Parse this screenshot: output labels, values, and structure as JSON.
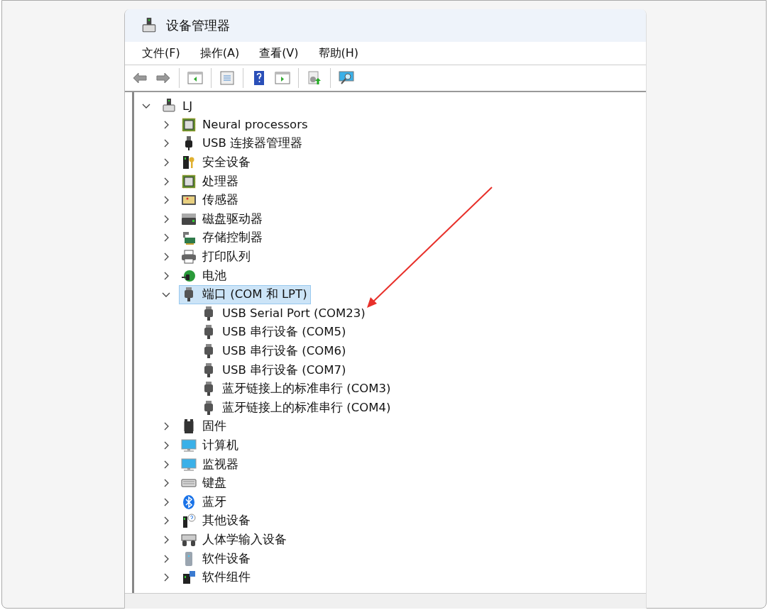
{
  "window": {
    "title": "设备管理器"
  },
  "menu": [
    {
      "label": "文件(F)"
    },
    {
      "label": "操作(A)"
    },
    {
      "label": "查看(V)"
    },
    {
      "label": "帮助(H)"
    }
  ],
  "tree": {
    "label": "LJ",
    "expanded": true,
    "selected": false,
    "children": [
      {
        "label": "Neural processors",
        "expanded": false,
        "selected": false
      },
      {
        "label": "USB 连接器管理器",
        "expanded": false,
        "selected": false
      },
      {
        "label": "安全设备",
        "expanded": false,
        "selected": false
      },
      {
        "label": "处理器",
        "expanded": false,
        "selected": false
      },
      {
        "label": "传感器",
        "expanded": false,
        "selected": false
      },
      {
        "label": "磁盘驱动器",
        "expanded": false,
        "selected": false
      },
      {
        "label": "存储控制器",
        "expanded": false,
        "selected": false
      },
      {
        "label": "打印队列",
        "expanded": false,
        "selected": false
      },
      {
        "label": "电池",
        "expanded": false,
        "selected": false
      },
      {
        "label": "端口 (COM 和 LPT)",
        "expanded": true,
        "selected": true,
        "children": [
          {
            "label": "USB Serial Port (COM23)",
            "selected": false
          },
          {
            "label": "USB 串行设备 (COM5)",
            "selected": false
          },
          {
            "label": "USB 串行设备 (COM6)",
            "selected": false
          },
          {
            "label": "USB 串行设备 (COM7)",
            "selected": false
          },
          {
            "label": "蓝牙链接上的标准串行 (COM3)",
            "selected": false
          },
          {
            "label": "蓝牙链接上的标准串行 (COM4)",
            "selected": false
          }
        ]
      },
      {
        "label": "固件",
        "expanded": false,
        "selected": false
      },
      {
        "label": "计算机",
        "expanded": false,
        "selected": false
      },
      {
        "label": "监视器",
        "expanded": false,
        "selected": false
      },
      {
        "label": "键盘",
        "expanded": false,
        "selected": false
      },
      {
        "label": "蓝牙",
        "expanded": false,
        "selected": false
      },
      {
        "label": "其他设备",
        "expanded": false,
        "selected": false
      },
      {
        "label": "人体学输入设备",
        "expanded": false,
        "selected": false
      },
      {
        "label": "软件设备",
        "expanded": false,
        "selected": false
      },
      {
        "label": "软件组件",
        "expanded": false,
        "selected": false
      }
    ]
  }
}
